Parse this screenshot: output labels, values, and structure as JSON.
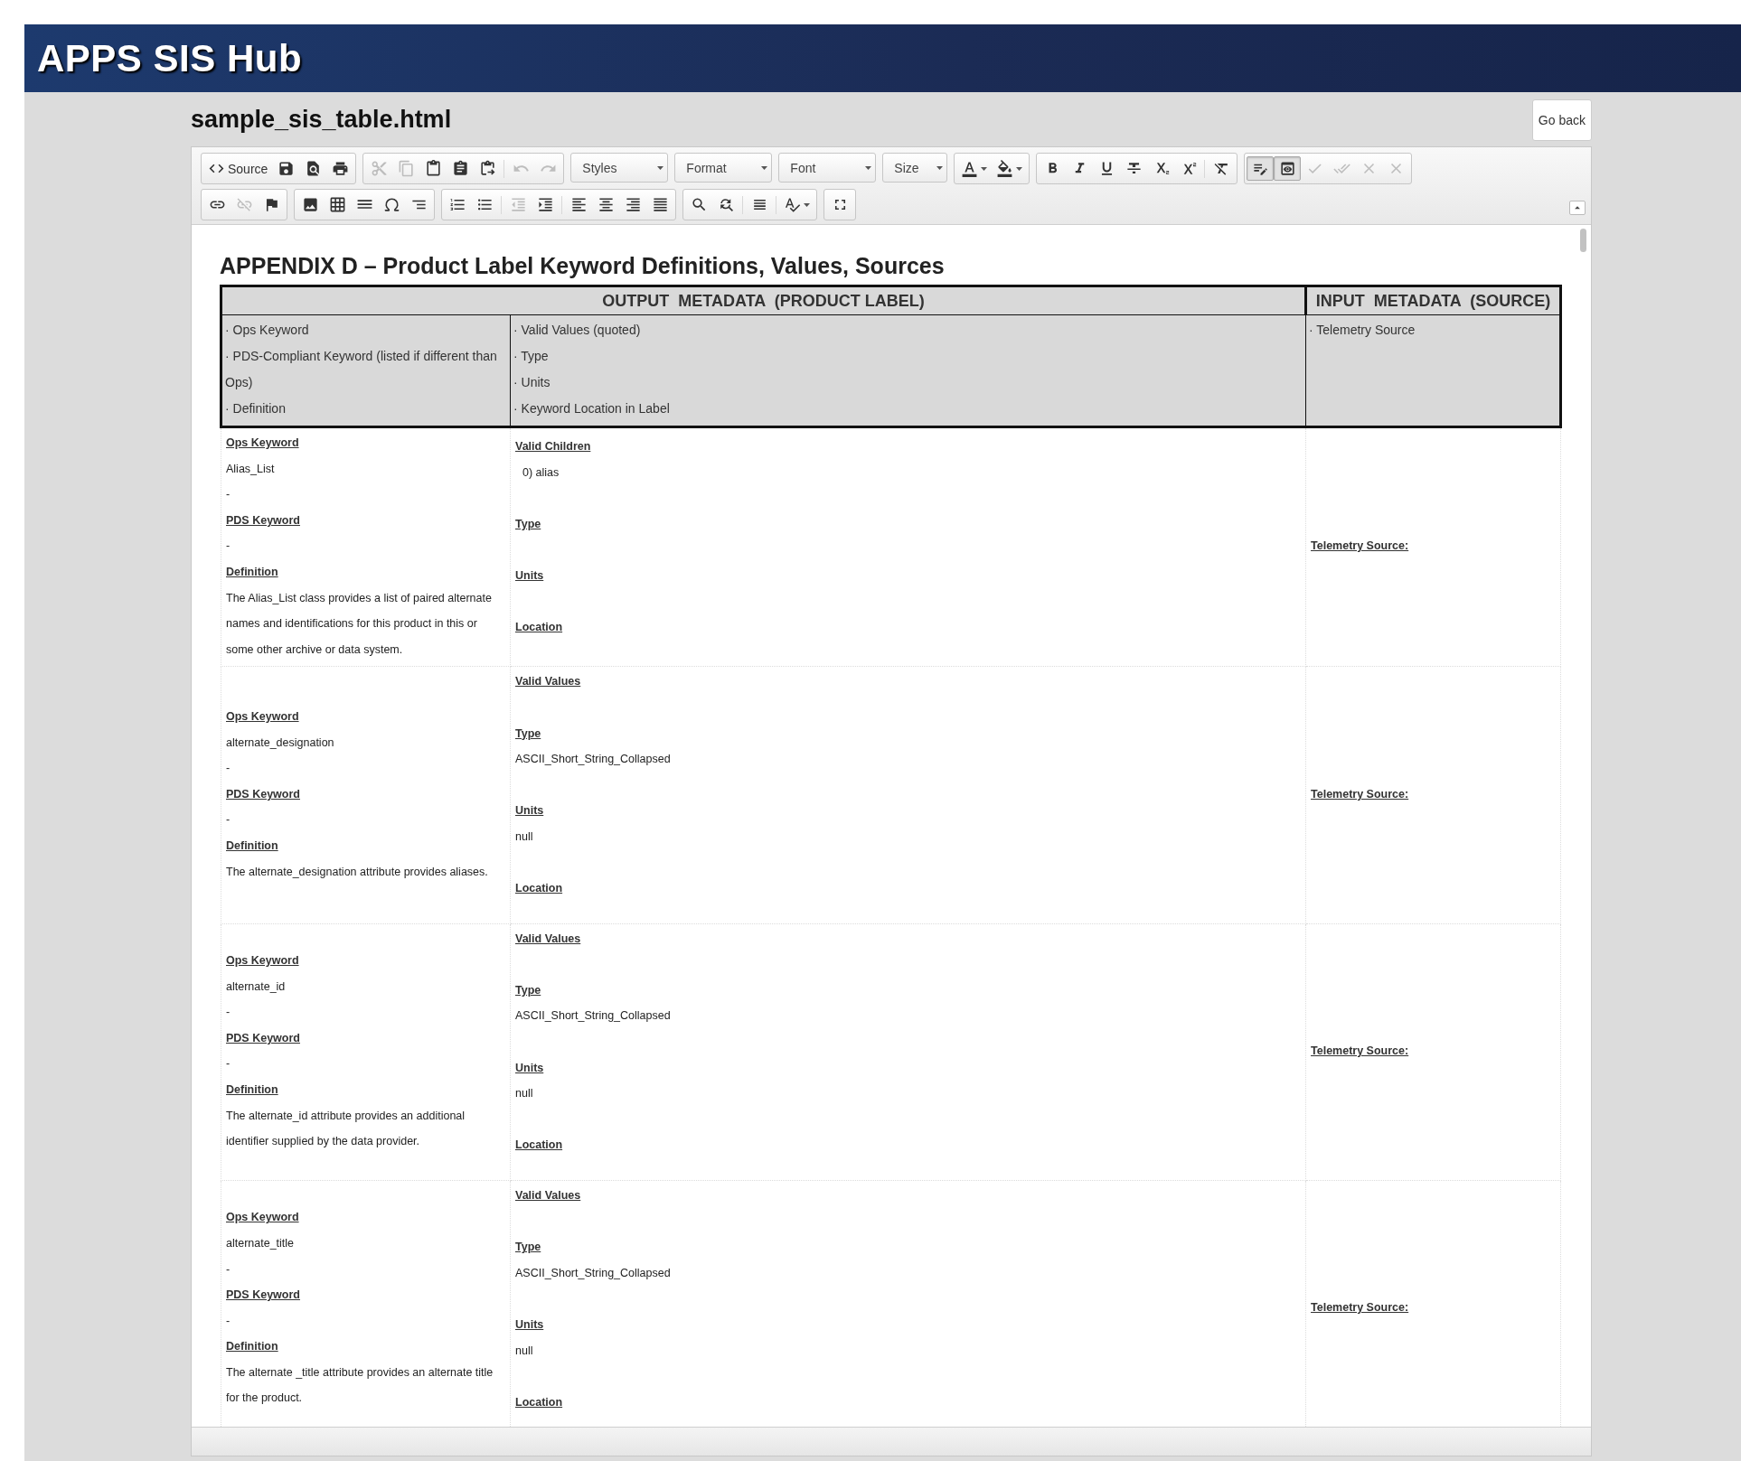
{
  "app": {
    "title": "APPS SIS Hub"
  },
  "document": {
    "filename": "sample_sis_table.html",
    "back_button": "Go back"
  },
  "toolbar": [
    [
      [
        {
          "kind": "labeled",
          "label": "Source",
          "disabled": false,
          "on": false
        },
        {
          "kind": "icon",
          "disabled": false,
          "on": false
        },
        {
          "kind": "icon",
          "disabled": false,
          "on": false
        },
        {
          "kind": "icon",
          "disabled": false,
          "on": false
        }
      ],
      [
        {
          "kind": "icon",
          "disabled": true,
          "on": false
        },
        {
          "kind": "icon",
          "disabled": true,
          "on": false
        },
        {
          "kind": "icon",
          "disabled": false,
          "on": false
        },
        {
          "kind": "icon",
          "disabled": false,
          "on": false
        },
        {
          "kind": "icon",
          "disabled": false,
          "on": false
        },
        {
          "kind": "separator"
        },
        {
          "kind": "icon",
          "disabled": true,
          "on": false
        },
        {
          "kind": "icon",
          "disabled": true,
          "on": false
        }
      ],
      [
        {
          "kind": "dropdown",
          "label": "Styles"
        }
      ],
      [
        {
          "kind": "dropdown",
          "label": "Format"
        }
      ],
      [
        {
          "kind": "dropdown",
          "label": "Font"
        }
      ],
      [
        {
          "kind": "dropdown",
          "label": "Size"
        }
      ],
      [
        {
          "kind": "split",
          "disabled": false,
          "on": false
        },
        {
          "kind": "split",
          "disabled": false,
          "on": false
        }
      ],
      [
        {
          "kind": "icon",
          "disabled": false,
          "on": false
        },
        {
          "kind": "icon",
          "disabled": false,
          "on": false
        },
        {
          "kind": "icon",
          "disabled": false,
          "on": false
        },
        {
          "kind": "icon",
          "disabled": false,
          "on": false
        },
        {
          "kind": "icon",
          "disabled": false,
          "on": false
        },
        {
          "kind": "icon",
          "disabled": false,
          "on": false
        },
        {
          "kind": "separator"
        },
        {
          "kind": "icon",
          "disabled": false,
          "on": false
        }
      ],
      [
        {
          "kind": "icon",
          "disabled": false,
          "on": true
        },
        {
          "kind": "icon",
          "disabled": false,
          "on": true
        },
        {
          "kind": "icon",
          "disabled": true,
          "on": false
        },
        {
          "kind": "icon",
          "disabled": true,
          "on": false
        },
        {
          "kind": "icon",
          "disabled": true,
          "on": false
        },
        {
          "kind": "icon",
          "disabled": true,
          "on": false
        }
      ]
    ],
    [
      [
        {
          "kind": "icon",
          "disabled": false,
          "on": false
        },
        {
          "kind": "icon",
          "disabled": true,
          "on": false
        },
        {
          "kind": "icon",
          "disabled": false,
          "on": false
        }
      ],
      [
        {
          "kind": "icon",
          "disabled": false,
          "on": false
        },
        {
          "kind": "icon",
          "disabled": false,
          "on": false
        },
        {
          "kind": "icon",
          "disabled": false,
          "on": false
        },
        {
          "kind": "icon",
          "disabled": false,
          "on": false
        },
        {
          "kind": "icon",
          "disabled": false,
          "on": false
        }
      ],
      [
        {
          "kind": "icon",
          "disabled": false,
          "on": false
        },
        {
          "kind": "icon",
          "disabled": false,
          "on": false
        },
        {
          "kind": "separator"
        },
        {
          "kind": "icon",
          "disabled": true,
          "on": false
        },
        {
          "kind": "icon",
          "disabled": false,
          "on": false
        },
        {
          "kind": "separator"
        },
        {
          "kind": "icon",
          "disabled": false,
          "on": false
        },
        {
          "kind": "icon",
          "disabled": false,
          "on": false
        },
        {
          "kind": "icon",
          "disabled": false,
          "on": false
        },
        {
          "kind": "icon",
          "disabled": false,
          "on": false
        }
      ],
      [
        {
          "kind": "icon",
          "disabled": false,
          "on": false
        },
        {
          "kind": "icon",
          "disabled": false,
          "on": false
        },
        {
          "kind": "separator"
        },
        {
          "kind": "icon",
          "disabled": false,
          "on": false
        },
        {
          "kind": "separator"
        },
        {
          "kind": "split",
          "disabled": false,
          "on": false
        }
      ],
      [
        {
          "kind": "icon",
          "disabled": false,
          "on": false
        }
      ]
    ]
  ],
  "content": {
    "heading": "APPENDIX D – Product Label Keyword Definitions, Values, Sources",
    "table": {
      "output_header": "OUTPUT  METADATA  (PRODUCT LABEL)",
      "input_header": "INPUT  METADATA  (SOURCE)",
      "legend_1": [
        "· Ops Keyword",
        "· PDS-Compliant Keyword (listed if different than Ops)",
        "· Definition"
      ],
      "legend_2": [
        "· Valid Values (quoted)",
        "· Type",
        "· Units",
        "· Keyword Location in Label"
      ],
      "legend_3": [
        "· Telemetry Source"
      ],
      "rows": [
        {
          "left": [
            {
              "kind": "label",
              "text": "Ops Keyword"
            },
            {
              "kind": "text",
              "text": "Alias_List"
            },
            {
              "kind": "text",
              "text": "-"
            },
            {
              "kind": "label",
              "text": "PDS Keyword"
            },
            {
              "kind": "text",
              "text": "-"
            },
            {
              "kind": "label",
              "text": "Definition"
            },
            {
              "kind": "text",
              "text": "The Alias_List class provides a list of paired alternate names and identifications for this product in this or some other archive or data system."
            }
          ],
          "fields": [
            {
              "label": "Valid Children",
              "value": "0) alias"
            },
            {
              "label": "Type"
            },
            {
              "label": "Units"
            },
            {
              "label": "Location"
            }
          ],
          "source": "Telemetry Source:"
        },
        {
          "left": [
            {
              "kind": "label",
              "text": "Ops Keyword"
            },
            {
              "kind": "text",
              "text": "alternate_designation"
            },
            {
              "kind": "text",
              "text": "-"
            },
            {
              "kind": "label",
              "text": "PDS Keyword"
            },
            {
              "kind": "text",
              "text": "-"
            },
            {
              "kind": "label",
              "text": "Definition"
            },
            {
              "kind": "text",
              "text": "The alternate_designation attribute provides aliases."
            }
          ],
          "fields": [
            {
              "label": "Valid Values"
            },
            {
              "label": "Type",
              "value": "ASCII_Short_String_Collapsed"
            },
            {
              "label": "Units",
              "value": "null"
            },
            {
              "label": "Location"
            }
          ],
          "source": "Telemetry Source:"
        },
        {
          "left": [
            {
              "kind": "label",
              "text": "Ops Keyword"
            },
            {
              "kind": "text",
              "text": "alternate_id"
            },
            {
              "kind": "text",
              "text": "-"
            },
            {
              "kind": "label",
              "text": "PDS Keyword"
            },
            {
              "kind": "text",
              "text": "-"
            },
            {
              "kind": "label",
              "text": "Definition"
            },
            {
              "kind": "text",
              "text": "The alternate_id attribute provides an additional identifier supplied by the data provider."
            }
          ],
          "fields": [
            {
              "label": "Valid Values"
            },
            {
              "label": "Type",
              "value": "ASCII_Short_String_Collapsed"
            },
            {
              "label": "Units",
              "value": "null"
            },
            {
              "label": "Location"
            }
          ],
          "source": "Telemetry Source:"
        },
        {
          "left": [
            {
              "kind": "label",
              "text": "Ops Keyword"
            },
            {
              "kind": "text",
              "text": "alternate_title"
            },
            {
              "kind": "text",
              "text": "-"
            },
            {
              "kind": "label",
              "text": "PDS Keyword"
            },
            {
              "kind": "text",
              "text": "-"
            },
            {
              "kind": "label",
              "text": "Definition"
            },
            {
              "kind": "text",
              "text": "The alternate _title attribute provides an alternate title for the product."
            }
          ],
          "fields": [
            {
              "label": "Valid Values"
            },
            {
              "label": "Type",
              "value": "ASCII_Short_String_Collapsed"
            },
            {
              "label": "Units",
              "value": "null"
            },
            {
              "label": "Location"
            }
          ],
          "source": "Telemetry Source:"
        }
      ]
    }
  }
}
